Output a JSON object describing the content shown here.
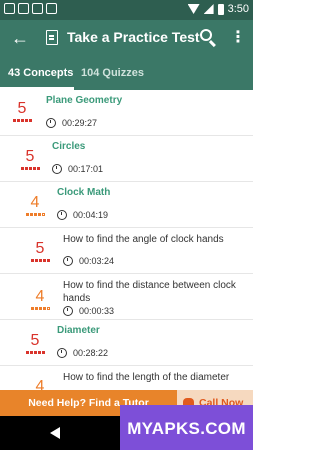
{
  "status_bar": {
    "time": "3:50"
  },
  "app_bar": {
    "title": "Take a Practice Test",
    "back_icon": "arrow-back-icon",
    "doc_icon": "document-icon",
    "search_icon": "search-icon",
    "more_icon": "more-vert-icon"
  },
  "tabs": [
    {
      "label": "43 Concepts",
      "active": true
    },
    {
      "label": "104 Quizzes",
      "active": false
    }
  ],
  "colors": {
    "primary": "#3b7867",
    "status": "#2e5e50",
    "accent_green": "#3b9a7a",
    "score_red": "#d9332b",
    "score_orange": "#ee7d2a",
    "help_orange": "#e8842a",
    "watermark": "#7d4fd8"
  },
  "rows": [
    {
      "score": "5",
      "title": "Plane Geometry",
      "time": "00:29:27",
      "type": "concept",
      "color": "#d9332b"
    },
    {
      "score": "5",
      "title": "Circles",
      "time": "00:17:01",
      "type": "concept",
      "color": "#d9332b"
    },
    {
      "score": "4",
      "title": "Clock Math",
      "time": "00:04:19",
      "type": "concept",
      "color": "#ee7d2a"
    },
    {
      "score": "5",
      "title": "How to find the angle of clock hands",
      "time": "00:03:24",
      "type": "question",
      "color": "#d9332b"
    },
    {
      "score": "4",
      "title": "How to find the distance between clock hands",
      "time": "00:00:33",
      "type": "question",
      "color": "#ee7d2a"
    },
    {
      "score": "5",
      "title": "Diameter",
      "time": "00:28:22",
      "type": "concept",
      "color": "#d9332b"
    },
    {
      "score": "4",
      "title": "How to find the length of the diameter",
      "time": "",
      "type": "question",
      "color": "#ee7d2a"
    }
  ],
  "footer": {
    "help_label": "Need Help? Find a Tutor",
    "call_label": "Call Now",
    "phone_icon": "phone-icon"
  },
  "watermark": "MYAPKS.COM"
}
